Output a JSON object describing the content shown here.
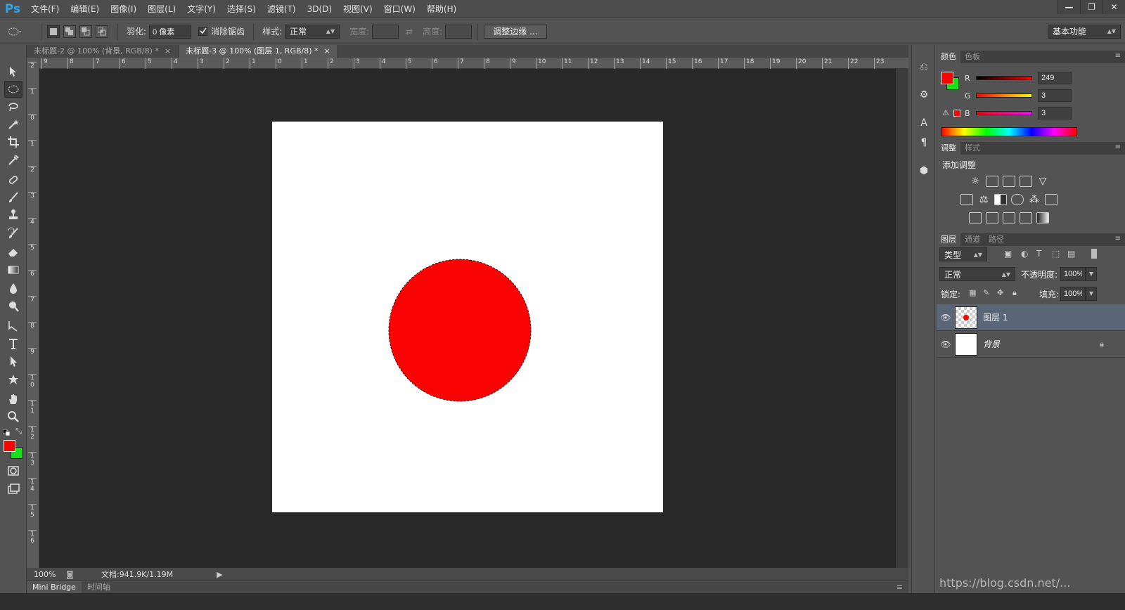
{
  "app": {
    "logo": "Ps"
  },
  "menu": [
    "文件(F)",
    "编辑(E)",
    "图像(I)",
    "图层(L)",
    "文字(Y)",
    "选择(S)",
    "滤镜(T)",
    "3D(D)",
    "视图(V)",
    "窗口(W)",
    "帮助(H)"
  ],
  "window_controls": [
    "—",
    "❐",
    "✕"
  ],
  "options": {
    "feather_label": "羽化:",
    "feather_value": "0 像素",
    "antialias_label": "消除锯齿",
    "style_label": "样式:",
    "style_value": "正常",
    "width_label": "宽度:",
    "height_label": "高度:",
    "refine_edge": "调整边缘 ...",
    "workspace": "基本功能"
  },
  "tabs": [
    {
      "label": "未标题-2 @ 100% (背景, RGB/8) *",
      "close": "×"
    },
    {
      "label": "未标题-3 @ 100% (图层 1, RGB/8) *",
      "close": "×"
    }
  ],
  "ruler": {
    "h": [
      "9",
      "8",
      "7",
      "6",
      "5",
      "4",
      "3",
      "2",
      "1",
      "0",
      "1",
      "2",
      "3",
      "4",
      "5",
      "6",
      "7",
      "8",
      "9",
      "10",
      "11",
      "12",
      "13",
      "14",
      "15",
      "16",
      "17",
      "18",
      "19",
      "20",
      "21",
      "22",
      "23"
    ],
    "v": [
      "2",
      "1",
      "0",
      "1",
      "2",
      "3",
      "4",
      "5",
      "6",
      "7",
      "8",
      "9",
      "1 0",
      "1 1",
      "1 2",
      "1 3",
      "1 4",
      "1 5",
      "1 6"
    ]
  },
  "status": {
    "zoom": "100%",
    "doc": "文档:941.9K/1.19M"
  },
  "bottom_tabs": [
    "Mini Bridge",
    "时间轴"
  ],
  "colors": {
    "foreground": "#f90303",
    "background": "#19e119",
    "circle": "#f90303"
  },
  "color_panel": {
    "tabs": [
      "颜色",
      "色板"
    ],
    "r_label": "R",
    "g_label": "G",
    "b_label": "B",
    "r": "249",
    "g": "3",
    "b": "3"
  },
  "adjust_panel": {
    "tabs": [
      "调整",
      "样式"
    ],
    "title": "添加调整"
  },
  "layers_panel": {
    "tabs": [
      "图层",
      "通道",
      "路径"
    ],
    "filter": "类型",
    "blend": "正常",
    "opacity_label": "不透明度:",
    "opacity": "100%",
    "lock_label": "锁定:",
    "fill_label": "填充:",
    "fill": "100%",
    "layers": [
      {
        "name": "图层 1",
        "selected": true
      },
      {
        "name": "背景",
        "selected": false
      }
    ]
  },
  "watermark": "https://blog.csdn.net/..."
}
